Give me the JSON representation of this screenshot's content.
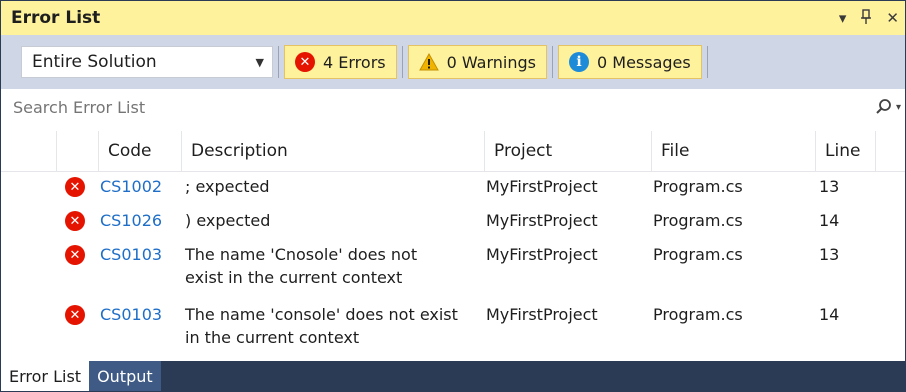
{
  "window": {
    "title": "Error List",
    "controls": {
      "dropdown": "▾",
      "pin": "ꟸ",
      "close": "✕"
    }
  },
  "toolbar": {
    "scope": "Entire Solution",
    "errors_label": "4 Errors",
    "warnings_label": "0 Warnings",
    "messages_label": "0 Messages"
  },
  "search": {
    "placeholder": "Search Error List"
  },
  "table": {
    "columns": {
      "code": "Code",
      "description": "Description",
      "project": "Project",
      "file": "File",
      "line": "Line"
    },
    "rows": [
      {
        "code": "CS1002",
        "description": [
          "; expected"
        ],
        "project": "MyFirstProject",
        "file": "Program.cs",
        "line": "13"
      },
      {
        "code": "CS1026",
        "description": [
          ") expected"
        ],
        "project": "MyFirstProject",
        "file": "Program.cs",
        "line": "14"
      },
      {
        "code": "CS0103",
        "description": [
          "The name 'Cnosole' does not",
          "exist in the current context"
        ],
        "project": "MyFirstProject",
        "file": "Program.cs",
        "line": "13"
      },
      {
        "code": "CS0103",
        "description": [
          "The name 'console' does not exist",
          "in the current context"
        ],
        "project": "MyFirstProject",
        "file": "Program.cs",
        "line": "14"
      }
    ]
  },
  "tabs": [
    {
      "label": "Error List",
      "active": true
    },
    {
      "label": "Output",
      "active": false
    }
  ],
  "colors": {
    "accent_yellow": "#fff29d",
    "toolbar_bg": "#cfd6e5",
    "error_red": "#e51400",
    "code_link": "#1e6ec8",
    "tabbar_bg": "#2b3a55"
  },
  "icons": {
    "error": "error-icon",
    "warning": "warning-icon",
    "info": "info-icon",
    "search": "search-icon"
  }
}
